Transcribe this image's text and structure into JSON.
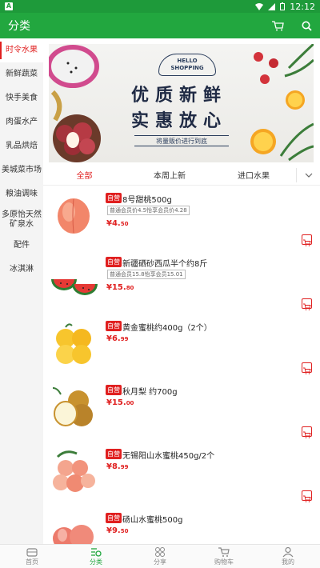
{
  "status": {
    "time": "12:12",
    "notif_icon": "A"
  },
  "appbar": {
    "title": "分类",
    "cart_icon": "cart-icon",
    "search_icon": "search-icon"
  },
  "sidebar": {
    "items": [
      {
        "label": "时令水果",
        "active": true
      },
      {
        "label": "新鲜蔬菜"
      },
      {
        "label": "快手美食"
      },
      {
        "label": "肉蛋水产"
      },
      {
        "label": "乳品烘焙"
      },
      {
        "label": "美城菜市场"
      },
      {
        "label": "粮油调味"
      },
      {
        "label": "多原怡天然矿泉水"
      },
      {
        "label": "配件"
      },
      {
        "label": "冰淇淋"
      }
    ]
  },
  "banner": {
    "hello": "HELLO",
    "shopping": "SHOPPING",
    "line1": "优质新鲜",
    "line2": "实惠放心",
    "ribbon": "将量贩价进行到底"
  },
  "tabs": {
    "items": [
      {
        "label": "全部",
        "active": true
      },
      {
        "label": "本周上新"
      },
      {
        "label": "进口水果"
      }
    ],
    "more_icon": "chevron-down-icon"
  },
  "products": [
    {
      "badge": "自营",
      "name": "8号甜桃500g",
      "member": "普通会员价4.5怡享会员价4.28",
      "price_int": "¥4.",
      "price_dec": "50",
      "fruit": "peach"
    },
    {
      "badge": "自营",
      "name": "新疆硒砂西瓜半个约8斤",
      "member": "普通会员15.8怡享会员15.01",
      "price_int": "¥15.",
      "price_dec": "80",
      "fruit": "watermelon"
    },
    {
      "badge": "自营",
      "name": "黄金蜜桃约400g（2个）",
      "member": "",
      "price_int": "¥6.",
      "price_dec": "99",
      "fruit": "yellowpeach"
    },
    {
      "badge": "自营",
      "name": "秋月梨 约700g",
      "member": "",
      "price_int": "¥15.",
      "price_dec": "00",
      "fruit": "pear"
    },
    {
      "badge": "自营",
      "name": "无锡阳山水蜜桃450g/2个",
      "member": "",
      "price_int": "¥8.",
      "price_dec": "99",
      "fruit": "whitepeach"
    },
    {
      "badge": "自营",
      "name": "砀山水蜜桃500g",
      "member": "",
      "price_int": "¥9.",
      "price_dec": "50",
      "fruit": "peach2"
    }
  ],
  "bottomnav": {
    "items": [
      {
        "label": "首页",
        "icon": "home-icon"
      },
      {
        "label": "分类",
        "icon": "category-icon",
        "active": true
      },
      {
        "label": "分享",
        "icon": "share-icon"
      },
      {
        "label": "购物车",
        "icon": "cart-icon"
      },
      {
        "label": "我的",
        "icon": "profile-icon"
      }
    ]
  },
  "colors": {
    "brand": "#22a73f",
    "accent": "#e02020"
  }
}
